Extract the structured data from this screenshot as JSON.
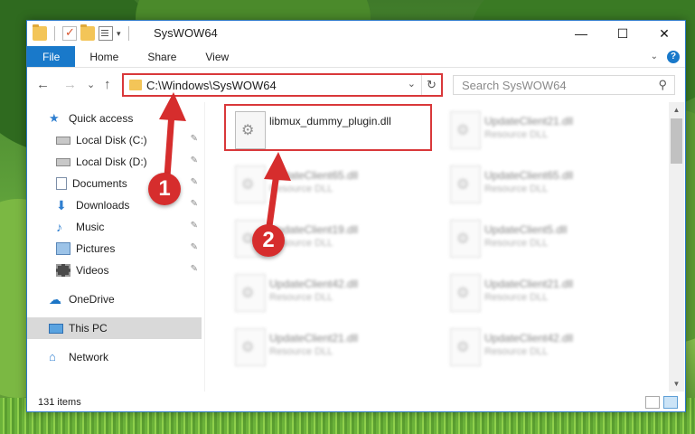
{
  "window": {
    "title": "SysWOW64",
    "controls": {
      "minimize": "—",
      "maximize": "☐",
      "close": "✕"
    }
  },
  "ribbon": {
    "tabs": [
      "File",
      "Home",
      "Share",
      "View"
    ],
    "help": "?",
    "collapse": "⌄"
  },
  "address": {
    "path": "C:\\Windows\\SysWOW64",
    "dropdown": "⌄",
    "refresh": "↻"
  },
  "search": {
    "placeholder": "Search SysWOW64",
    "icon": "⚲"
  },
  "nav_buttons": {
    "back": "←",
    "forward": "→",
    "recent": "⌄",
    "up": "↑"
  },
  "sidebar": {
    "items": [
      {
        "label": "Quick access",
        "icon": "star-icon"
      },
      {
        "label": "Local Disk (C:)",
        "icon": "disk-icon",
        "pinned": true
      },
      {
        "label": "Local Disk (D:)",
        "icon": "disk-icon",
        "pinned": true
      },
      {
        "label": "Documents",
        "icon": "documents-icon",
        "pinned": true
      },
      {
        "label": "Downloads",
        "icon": "downloads-icon",
        "pinned": true
      },
      {
        "label": "Music",
        "icon": "music-icon",
        "pinned": true
      },
      {
        "label": "Pictures",
        "icon": "pictures-icon",
        "pinned": true
      },
      {
        "label": "Videos",
        "icon": "videos-icon",
        "pinned": true
      },
      {
        "label": "OneDrive",
        "icon": "onedrive-icon"
      },
      {
        "label": "This PC",
        "icon": "this-pc-icon",
        "selected": true
      },
      {
        "label": "Network",
        "icon": "network-icon"
      }
    ],
    "pin_glyph": "📌"
  },
  "files": [
    {
      "name": "libmux_dummy_plugin.dll",
      "type": "",
      "highlighted": true
    },
    {
      "name": "UpdateClient21.dll",
      "type": "Resource DLL"
    },
    {
      "name": "UpdateClient65.dll",
      "type": "Resource DLL"
    },
    {
      "name": "UpdateClient65.dll",
      "type": "Resource DLL"
    },
    {
      "name": "UpdateClient19.dll",
      "type": "Resource DLL"
    },
    {
      "name": "UpdateClient5.dll",
      "type": "Resource DLL"
    },
    {
      "name": "UpdateClient42.dll",
      "type": "Resource DLL"
    },
    {
      "name": "UpdateClient21.dll",
      "type": "Resource DLL"
    },
    {
      "name": "UpdateClient21.dll",
      "type": "Resource DLL"
    },
    {
      "name": "UpdateClient42.dll",
      "type": "Resource DLL"
    }
  ],
  "status": {
    "item_count": "131 items"
  },
  "annotations": {
    "step1": "1",
    "step2": "2"
  },
  "colors": {
    "accent": "#1979ca",
    "highlight_border": "#d9383a",
    "callout": "#d62d2d"
  }
}
